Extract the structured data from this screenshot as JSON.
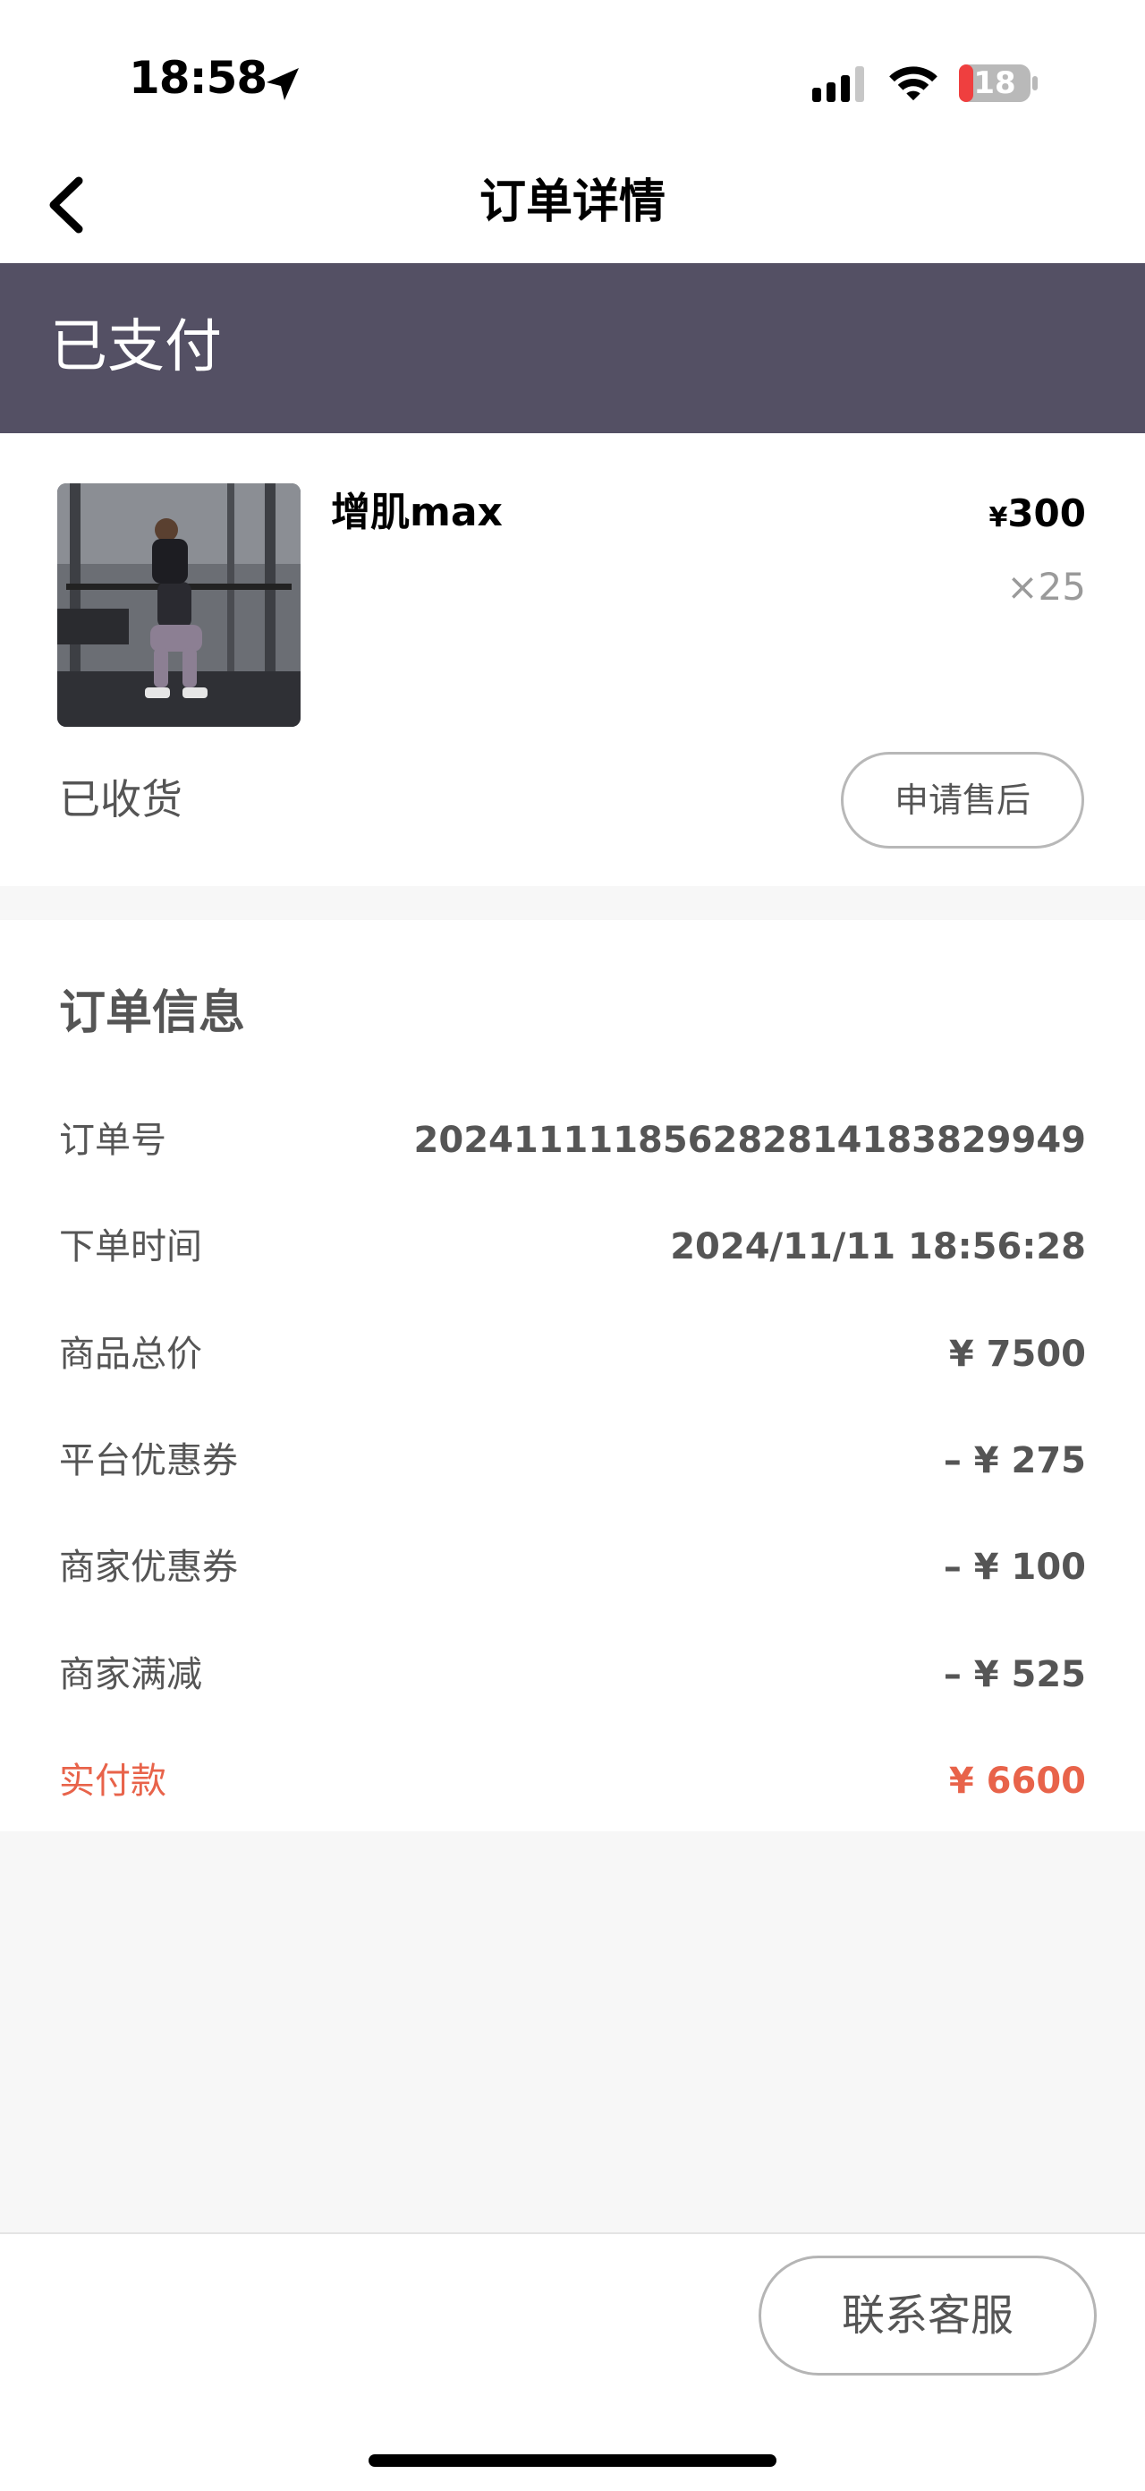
{
  "status_bar": {
    "time": "18:58",
    "battery": "18"
  },
  "nav": {
    "title": "订单详情"
  },
  "banner": {
    "status": "已支付"
  },
  "product": {
    "name": "增肌max",
    "price_symbol": "¥",
    "price": "300",
    "quantity": "×25",
    "delivery_status": "已收货",
    "aftersale_label": "申请售后"
  },
  "order_info": {
    "title": "订单信息",
    "rows": [
      {
        "label": "订单号",
        "value": "20241111185628281418382​9949"
      },
      {
        "label": "下单时间",
        "value": "2024/11/11 18:56:28"
      },
      {
        "label": "商品总价",
        "value": "¥ 7500"
      },
      {
        "label": "平台优惠券",
        "value": "– ¥ 275"
      },
      {
        "label": "商家优惠券",
        "value": "– ¥ 100"
      },
      {
        "label": "商家满减",
        "value": "– ¥ 525"
      },
      {
        "label": "实付款",
        "value": "¥ 6600"
      }
    ]
  },
  "footer": {
    "service_label": "联系客服"
  },
  "colors": {
    "banner": "#545064",
    "accent": "#e8634a",
    "battery_low": "#ef3f3f"
  }
}
